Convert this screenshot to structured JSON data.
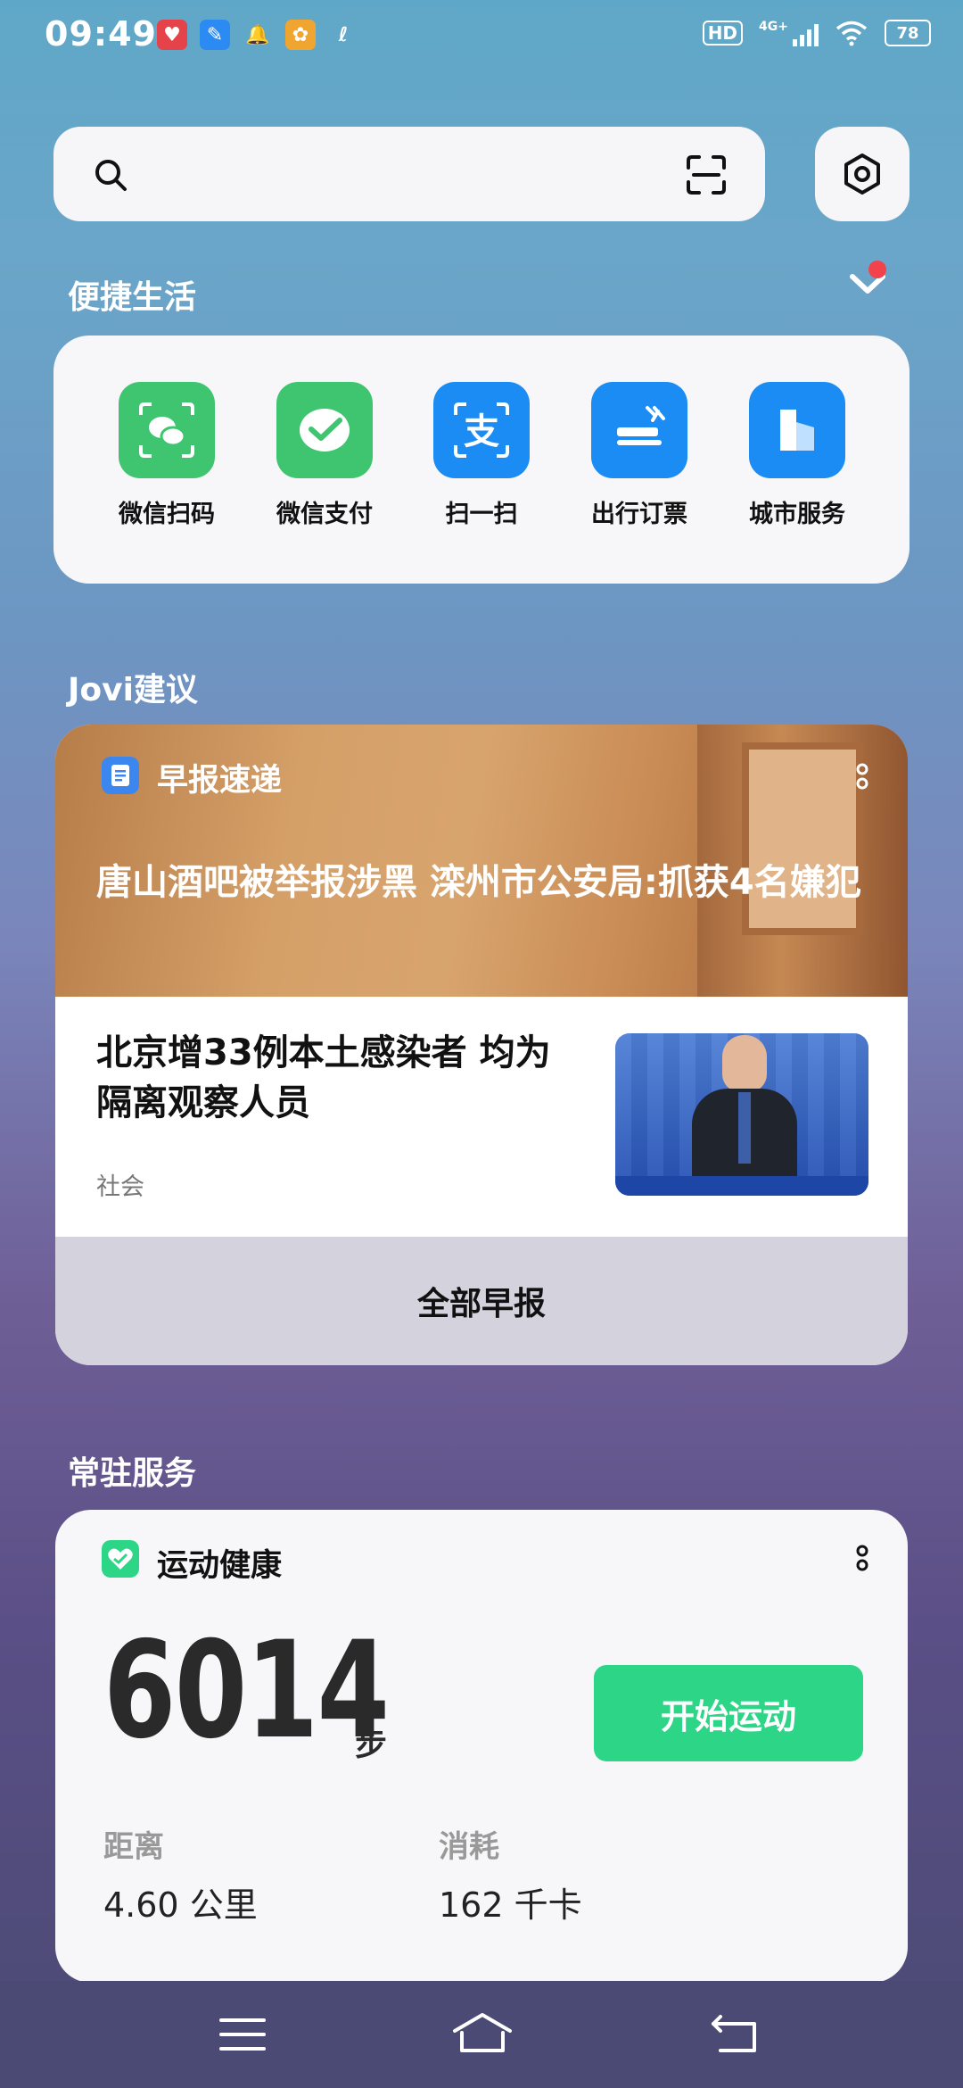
{
  "status_bar": {
    "time": "09:49",
    "hd_label": "HD",
    "network_label": "4G+",
    "battery_level": "78"
  },
  "search": {
    "search_icon": "search-icon",
    "scan_icon": "scan-icon"
  },
  "settings": {
    "icon": "hexagon-settings-icon"
  },
  "quick_life": {
    "title": "便捷生活",
    "items": [
      {
        "label": "微信扫码",
        "icon": "wechat-scan-icon",
        "color": "#3fc56f"
      },
      {
        "label": "微信支付",
        "icon": "wechat-pay-icon",
        "color": "#3fc56f"
      },
      {
        "label": "扫一扫",
        "icon": "alipay-scan-icon",
        "color": "#1b8cf4"
      },
      {
        "label": "出行订票",
        "icon": "flight-ticket-icon",
        "color": "#1b8cf4"
      },
      {
        "label": "城市服务",
        "icon": "city-service-icon",
        "color": "#1b8cf4"
      }
    ]
  },
  "jovi": {
    "title": "Jovi建议",
    "card_title": "早报速递",
    "headline": "唐山酒吧被举报涉黑 滦州市公安局:抓获4名嫌犯",
    "item_title": "北京增33例本土感染者 均为隔离观察人员",
    "item_tag": "社会",
    "more_label": "全部早报"
  },
  "resident": {
    "title": "常驻服务",
    "card_title": "运动健康",
    "steps": "6014",
    "steps_unit": "步",
    "start_button": "开始运动",
    "distance_label": "距离",
    "distance_value": "4.60 公里",
    "calories_label": "消耗",
    "calories_value": "162 千卡"
  },
  "colors": {
    "accent_green": "#2dd587",
    "alert_red": "#f2434d"
  }
}
